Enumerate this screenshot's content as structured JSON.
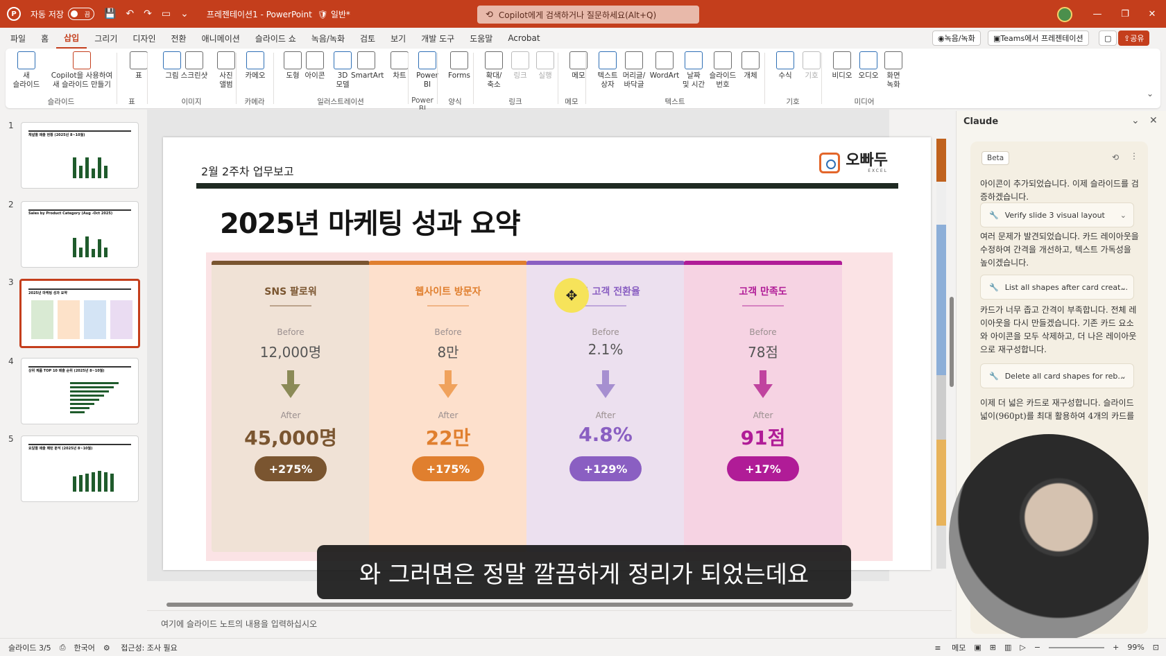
{
  "titlebar": {
    "autosave_label": "자동 저장",
    "autosave_state": "끔",
    "doc_title": "프레젠테이션1 - PowerPoint",
    "sensitivity": "일반*",
    "search_placeholder": "Copilot에게 검색하거나 질문하세요(Alt+Q)"
  },
  "menu": {
    "tabs": [
      "파일",
      "홈",
      "삽입",
      "그리기",
      "디자인",
      "전환",
      "애니메이션",
      "슬라이드 쇼",
      "녹음/녹화",
      "검토",
      "보기",
      "개발 도구",
      "도움말",
      "Acrobat"
    ],
    "active": "삽입",
    "record": "녹음/녹화",
    "teams": "Teams에서 프레젠테이션",
    "share": "공유"
  },
  "ribbon": {
    "items": [
      {
        "label": "새\n슬라이드"
      },
      {
        "label": "Copilot을 사용하여\n새 슬라이드 만들기"
      },
      {
        "label": "표"
      },
      {
        "label": "그림"
      },
      {
        "label": "스크린샷"
      },
      {
        "label": "사진\n앨범"
      },
      {
        "label": "카메오"
      },
      {
        "label": "도형"
      },
      {
        "label": "아이콘"
      },
      {
        "label": "3D\n모델"
      },
      {
        "label": "SmartArt"
      },
      {
        "label": "차트"
      },
      {
        "label": "Power\nBI"
      },
      {
        "label": "Forms"
      },
      {
        "label": "확대/\n축소"
      },
      {
        "label": "링크"
      },
      {
        "label": "실행"
      },
      {
        "label": "메모"
      },
      {
        "label": "텍스트\n상자"
      },
      {
        "label": "머리글/\n바닥글"
      },
      {
        "label": "WordArt"
      },
      {
        "label": "날짜\n및 시간"
      },
      {
        "label": "슬라이드\n번호"
      },
      {
        "label": "개체"
      },
      {
        "label": "수식"
      },
      {
        "label": "기호"
      },
      {
        "label": "비디오"
      },
      {
        "label": "오디오"
      },
      {
        "label": "화면\n녹화"
      }
    ],
    "groups": [
      "슬라이드",
      "표",
      "이미지",
      "카메라",
      "일러스트레이션",
      "Power BI",
      "양식",
      "링크",
      "메모",
      "텍스트",
      "기호",
      "미디어"
    ]
  },
  "thumbnails": {
    "numbers": [
      "1",
      "2",
      "3",
      "4",
      "5"
    ],
    "titles": [
      "채널별 매출 현황 (2025년 8~10월)",
      "Sales by Product Category (Aug -Oct 2025)",
      "2025년 마케팅 성과 요약",
      "상위 제품 TOP 10 매출 순위 (2025년 8~10월)",
      "요일별 매출 패턴 분석 (2025년 8~10월)"
    ],
    "selected_index": 2
  },
  "slide": {
    "subtitle": "2월 2주차 업무보고",
    "brand_name": "오빠두",
    "brand_sub": "EXCEL",
    "title": "2025년 마케팅 성과 요약",
    "before_label": "Before",
    "after_label": "After",
    "cards": [
      {
        "label": "SNS 팔로워",
        "before": "12,000명",
        "after": "45,000명",
        "change": "+275%",
        "accent": "#7a5530",
        "bg": "#f0e2d6",
        "arrow": "#8b8a57"
      },
      {
        "label": "웹사이트 방문자",
        "before": "8만",
        "after": "22만",
        "change": "+175%",
        "accent": "#e07f2e",
        "bg": "#fde0cc",
        "arrow": "#f0a25c"
      },
      {
        "label": "신규 고객 전환율",
        "before": "2.1%",
        "after": "4.8%",
        "change": "+129%",
        "accent": "#8a5fc2",
        "bg": "#ece0ef",
        "arrow": "#a68fd0"
      },
      {
        "label": "고객 만족도",
        "before": "78점",
        "after": "91점",
        "change": "+17%",
        "accent": "#b01c97",
        "bg": "#f6d3e3",
        "arrow": "#c0449f"
      }
    ]
  },
  "caption": "와 그러면은 정말 깔끔하게 정리가 되었는데요",
  "notes_placeholder": "여기에 슬라이드 노트의 내용을 입력하십시오",
  "claude": {
    "title": "Claude",
    "badge": "Beta",
    "messages": [
      "아이콘이 추가되었습니다. 이제 슬라이드를 검증하겠습니다.",
      "여러 문제가 발견되었습니다. 카드 레이아웃을 수정하여 간격을 개선하고, 텍스트 가독성을 높이겠습니다.",
      "카드가 너무 좁고 간격이 부족합니다. 전체 레이아웃을 다시 만들겠습니다. 기존 카드 요소와 아이콘을 모두 삭제하고, 더 나은 레이아웃으로 재구성합니다.",
      "이제 더 넓은 카드로 재구성합니다. 슬라이드 넓이(960pt)를 최대 활용하여 4개의 카드를"
    ],
    "tools": [
      "Verify slide 3 visual layout",
      "List all shapes after card creat...",
      "Delete all card shapes for reb..."
    ]
  },
  "status": {
    "slide": "슬라이드 3/5",
    "language": "한국어",
    "accessibility": "접근성: 조사 필요",
    "notes": "메모",
    "zoom": "99%"
  }
}
